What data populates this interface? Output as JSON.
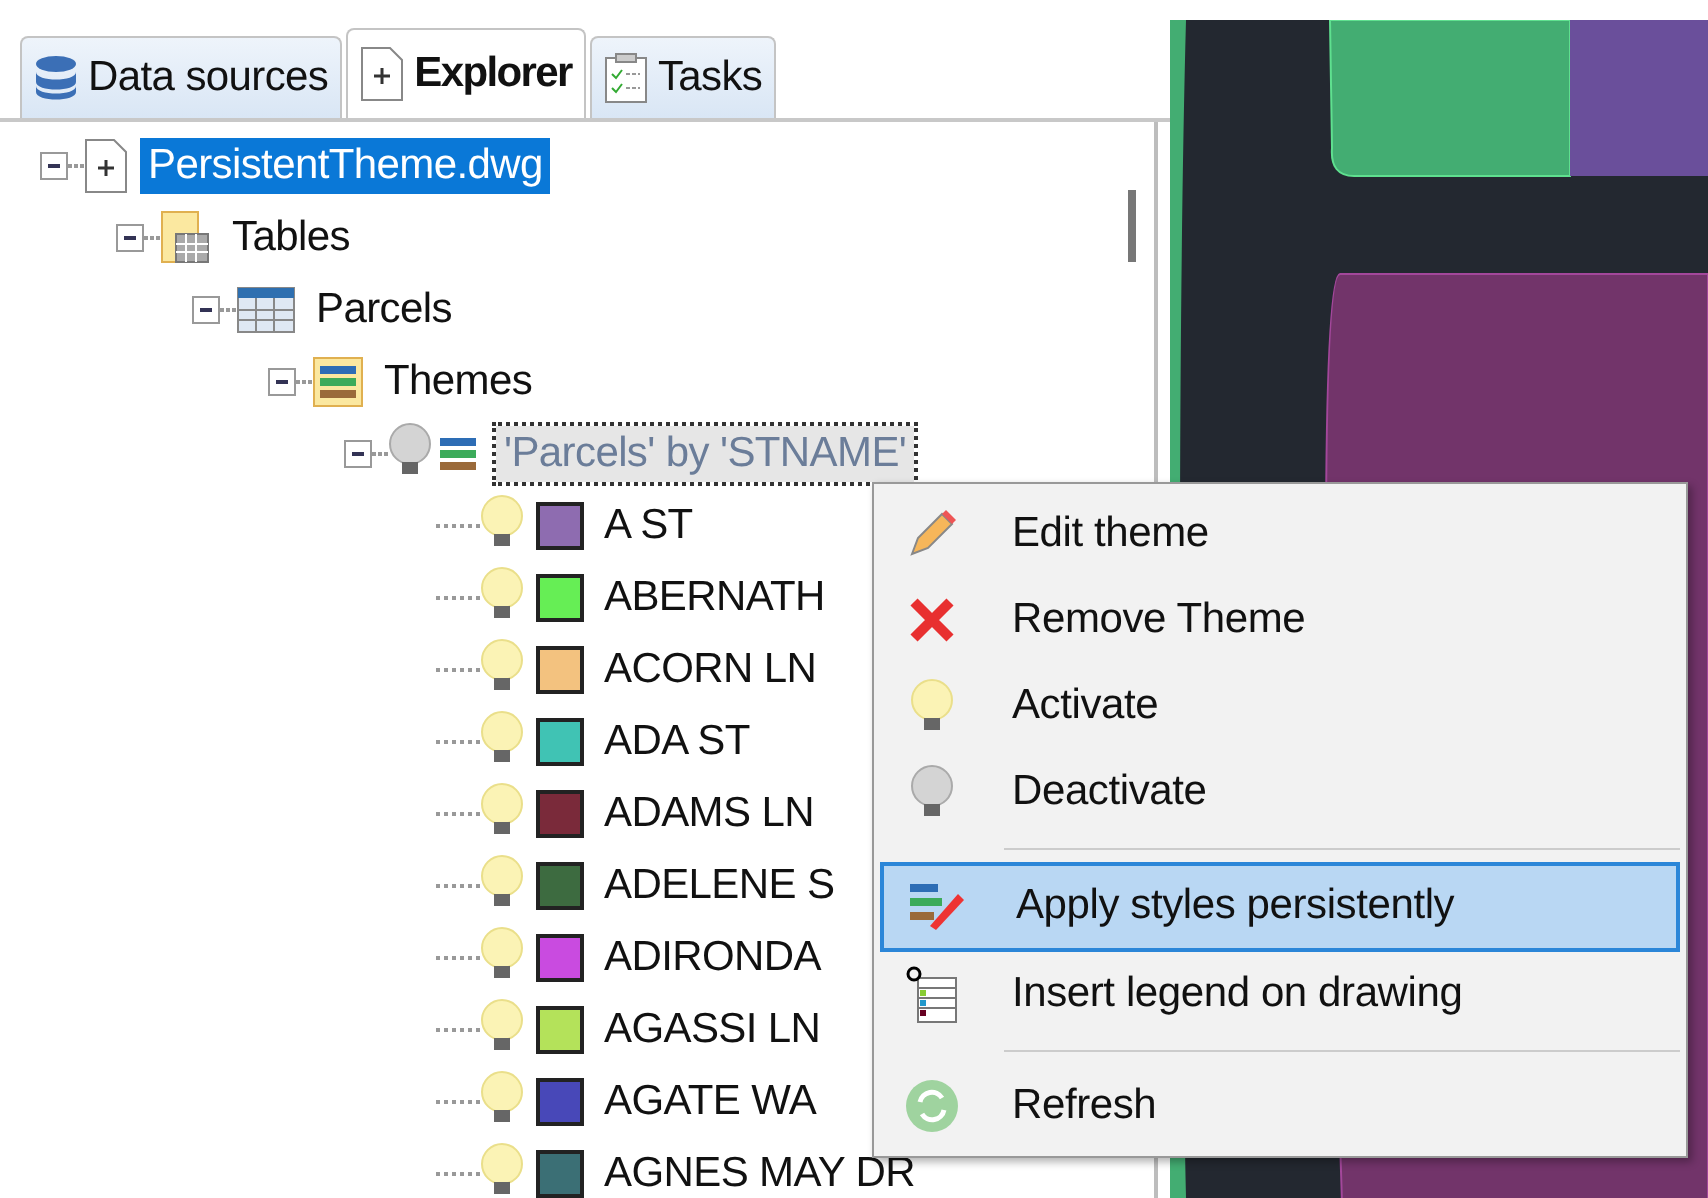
{
  "tabs": [
    {
      "label": "Data sources",
      "selected": false
    },
    {
      "label": "Explorer",
      "selected": true
    },
    {
      "label": "Tasks",
      "selected": false
    }
  ],
  "tree": [
    {
      "kind": "drawing",
      "label": "PersistentTheme.dwg",
      "selected": true,
      "expanded": true,
      "children": [
        {
          "kind": "tables",
          "label": "Tables",
          "selected": false,
          "expanded": true,
          "children": [
            {
              "kind": "table",
              "label": "Parcels",
              "selected": false,
              "expanded": true,
              "children": [
                {
                  "kind": "themes",
                  "label": "Themes",
                  "selected": false,
                  "expanded": true,
                  "children": [
                    {
                      "kind": "theme",
                      "label": "'Parcels' by 'STNAME'",
                      "selected": false,
                      "expanded": true,
                      "active": false,
                      "children": [
                        {
                          "kind": "style",
                          "label": "A ST",
                          "active": true,
                          "color": "#8e6cb0"
                        },
                        {
                          "kind": "style",
                          "label": "ABERNATH",
                          "active": true,
                          "color": "#66ee55"
                        },
                        {
                          "kind": "style",
                          "label": "ACORN LN",
                          "active": true,
                          "color": "#f3c27f"
                        },
                        {
                          "kind": "style",
                          "label": "ADA ST",
                          "active": true,
                          "color": "#40c3b4"
                        },
                        {
                          "kind": "style",
                          "label": "ADAMS LN",
                          "active": true,
                          "color": "#7a2a3a"
                        },
                        {
                          "kind": "style",
                          "label": "ADELENE S",
                          "active": true,
                          "color": "#3d6b40"
                        },
                        {
                          "kind": "style",
                          "label": "ADIRONDA",
                          "active": true,
                          "color": "#c94be0"
                        },
                        {
                          "kind": "style",
                          "label": "AGASSI LN",
                          "active": true,
                          "color": "#b4e25a"
                        },
                        {
                          "kind": "style",
                          "label": "AGATE WA",
                          "active": true,
                          "color": "#4848b8"
                        },
                        {
                          "kind": "style",
                          "label": "AGNES MAY DR",
                          "active": true,
                          "color": "#3b6f75"
                        }
                      ]
                    }
                  ]
                }
              ]
            }
          ]
        }
      ]
    }
  ],
  "context_menu": [
    {
      "label": "Edit theme",
      "selected": false,
      "separator_before": false
    },
    {
      "label": "Remove Theme",
      "selected": false,
      "separator_before": false
    },
    {
      "label": "Activate",
      "selected": false,
      "separator_before": false
    },
    {
      "label": "Deactivate",
      "selected": false,
      "separator_before": false
    },
    {
      "label": "Apply styles persistently",
      "selected": true,
      "separator_before": true
    },
    {
      "label": "Insert legend on drawing",
      "selected": false,
      "separator_before": false
    },
    {
      "label": "Refresh",
      "selected": false,
      "separator_before": true
    }
  ]
}
